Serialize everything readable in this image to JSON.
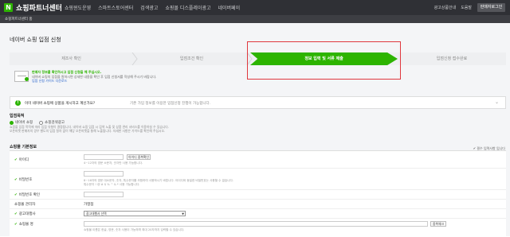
{
  "header": {
    "logo_letter": "N",
    "brand": "쇼핑파트너센터",
    "nav": [
      "쇼핑윈도운영",
      "스마트스토어센터",
      "검색광고",
      "쇼핑몰 디스플레이광고",
      "네이버페이"
    ],
    "right_links": [
      "광고상품안내",
      "도움말"
    ],
    "login_label": "판매자로그인",
    "sub_label": "쇼핑파트너센터 홈"
  },
  "page": {
    "title": "네이버 쇼핑 입점 신청"
  },
  "steps": [
    {
      "label": "제조사 확인",
      "active": false
    },
    {
      "label": "입점조건 확인",
      "active": false
    },
    {
      "label": "정보 입력 및 서류 제출",
      "active": true
    },
    {
      "label": "입점신청 접수완료",
      "active": false
    }
  ],
  "info": {
    "headline": "판매자 정보를 확인하시고 입점 신청을 해 주십시오.",
    "line1": "네이버 쇼핑의 입점을 원하시면 상세한 내용을 확인 후 입점 신청서를 작성해 주시기 바랍니다.",
    "link": "입점 신청 가이드 다운로드"
  },
  "notice": {
    "question": "이미 네이버 쇼핑에 상품을 게시하고 계신가요?",
    "desc": "기존 가입 정보를 이용한 입점신청 진행이 가능합니다.",
    "caret": "⌄"
  },
  "purpose": {
    "title": "입점목적",
    "options": [
      {
        "label": "네이버 쇼핑",
        "selected": true
      },
      {
        "label": "쇼핑검색광고",
        "selected": false
      }
    ],
    "desc1": "쇼핑몰 입점 목적에 따라 입점 유형이 결정됩니다. 네이버 쇼핑 입점 시 검색 노출 및 상품 관리 서비스를 이용하실 수 있습니다.",
    "desc2": "오픈마켓 판매자의 경우 별도의 입점 절차 없이 해당 오픈마켓을 통해 노출됩니다. 자세한 사항은 가이드를 확인해 주십시오."
  },
  "form": {
    "title": "쇼핑몰 기본정보",
    "required_note": "✔ 필수 입력사항 입니다",
    "rows": [
      {
        "label": "아이디",
        "required": true,
        "button": "아이디 중복확인",
        "hint": "4~12자의 영문 소문자, 숫자만 사용 가능합니다."
      },
      {
        "label": "비밀번호",
        "required": true,
        "hint": "8~16자의 영문 대소문자, 숫자, 특수문자를 조합하여 사용하시기 바랍니다. 아이디와 동일한 비밀번호는 사용할 수 없습니다.",
        "hint2": "특수문자 ! @ # $ % ^ & * 사용 가능합니다."
      },
      {
        "label": "비밀번호 확인",
        "required": true
      },
      {
        "label": "쇼핑몰 관리자",
        "required": false,
        "value": "가맹점"
      },
      {
        "label": "광고대행사",
        "required": true,
        "select": "광고대행사 선택"
      },
      {
        "label": "쇼핑몰 명",
        "required": true,
        "button": "중복체크",
        "hint": "쇼핑몰 이름은 한글, 영문, 숫자 사용이 가능하며 최대 20자까지 입력할 수 있습니다."
      }
    ]
  },
  "colors": {
    "brand_green": "#2db400",
    "highlight_red": "#e0383e",
    "topbar": "#2f3035"
  }
}
